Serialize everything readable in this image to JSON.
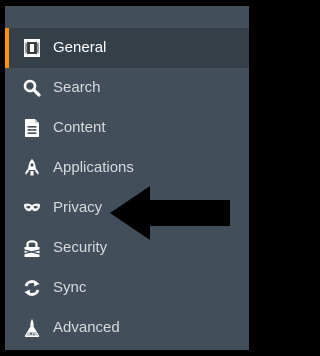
{
  "sidebar": {
    "items": [
      {
        "label": "General",
        "icon": "general-icon",
        "selected": true
      },
      {
        "label": "Search",
        "icon": "search-icon",
        "selected": false
      },
      {
        "label": "Content",
        "icon": "content-icon",
        "selected": false
      },
      {
        "label": "Applications",
        "icon": "applications-icon",
        "selected": false
      },
      {
        "label": "Privacy",
        "icon": "privacy-icon",
        "selected": false
      },
      {
        "label": "Security",
        "icon": "security-icon",
        "selected": false
      },
      {
        "label": "Sync",
        "icon": "sync-icon",
        "selected": false
      },
      {
        "label": "Advanced",
        "icon": "advanced-icon",
        "selected": false
      }
    ]
  },
  "colors": {
    "panel_bg": "#424f5a",
    "selected_bg": "#343f48",
    "accent": "#ff9500",
    "text": "#d6dadd",
    "frame": "#000000",
    "annotation_arrow": "#000000"
  },
  "annotation": {
    "type": "arrow",
    "points_to": "Privacy"
  }
}
